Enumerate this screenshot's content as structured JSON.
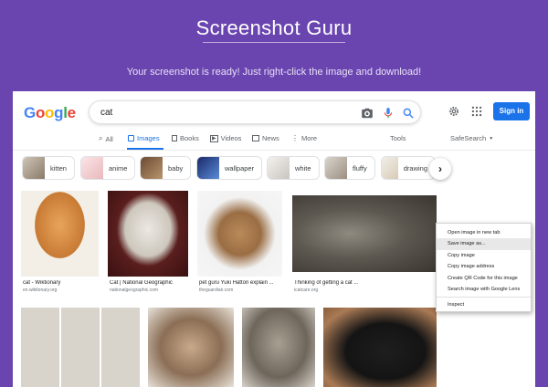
{
  "site": {
    "title": "Screenshot Guru",
    "message": "Your screenshot is ready! Just right-click the image and download!"
  },
  "google": {
    "logo_letters": [
      {
        "ch": "G",
        "color": "#4285f4"
      },
      {
        "ch": "o",
        "color": "#ea4335"
      },
      {
        "ch": "o",
        "color": "#fbbc05"
      },
      {
        "ch": "g",
        "color": "#4285f4"
      },
      {
        "ch": "l",
        "color": "#34a853"
      },
      {
        "ch": "e",
        "color": "#ea4335"
      }
    ],
    "query": "cat",
    "sign_in": "Sign in",
    "tabs": {
      "all": "All",
      "images": "Images",
      "books": "Books",
      "videos": "Videos",
      "news": "News",
      "more": "More",
      "tools": "Tools",
      "safesearch": "SafeSearch"
    },
    "chips": [
      "kitten",
      "anime",
      "baby",
      "wallpaper",
      "white",
      "fluffy",
      "drawing"
    ],
    "results": [
      {
        "caption": "cat - Wiktionary",
        "source": "en.wiktionary.org"
      },
      {
        "caption": "Cat | National Geographic",
        "source": "nationalgeographic.com"
      },
      {
        "caption": "pet guru Yuki Hattori explain ...",
        "source": "theguardian.com"
      },
      {
        "caption": "Thinking of getting a cat ...",
        "source": "icatcare.org"
      }
    ]
  },
  "context_menu": {
    "items": [
      "Open image in new tab",
      "Save image as...",
      "Copy image",
      "Copy image address",
      "Create QR Code for this image",
      "Search image with Google Lens",
      "Inspect"
    ],
    "highlighted": 1
  },
  "colors": {
    "background": "#6a45b0",
    "accent": "#1a73e8"
  }
}
